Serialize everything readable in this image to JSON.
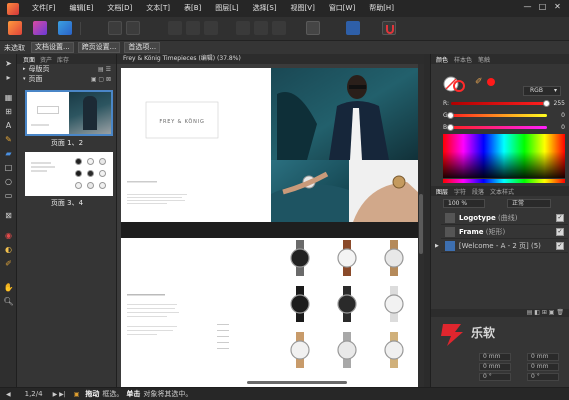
{
  "menu": [
    "文件[F]",
    "编辑[E]",
    "文档[D]",
    "文本[T]",
    "表[B]",
    "图层[L]",
    "选择[S]",
    "视图[V]",
    "窗口[W]",
    "帮助[H]"
  ],
  "window_controls": [
    "—",
    "□",
    "✕"
  ],
  "context": {
    "status": "未选取",
    "buttons": [
      "文档设置...",
      "跨页设置...",
      "首选项..."
    ]
  },
  "pages_panel": {
    "tabs": [
      "页面",
      "资产",
      "库存"
    ],
    "master_label": "母版页",
    "pages_label": "页面",
    "thumbs": [
      {
        "caption": "页面 1、2"
      },
      {
        "caption": "页面 3、4"
      }
    ]
  },
  "document": {
    "title": "Frey & König Timepieces (编辑) (37.8%)",
    "logo_text": "FREY & KÖNIG"
  },
  "color_panel": {
    "tabs": [
      "颜色",
      "样本色",
      "笔触"
    ],
    "mode": "RGB",
    "sliders": [
      {
        "label": "R:",
        "value": "255",
        "fraction": 1.0,
        "color": "#ff3030"
      },
      {
        "label": "G:",
        "value": "0",
        "fraction": 0.0,
        "color": "#c02020"
      },
      {
        "label": "B:",
        "value": "0",
        "fraction": 0.0,
        "color": "#c02020"
      }
    ]
  },
  "layers_panel": {
    "tabs": [
      "图层",
      "字符",
      "段落",
      "文本样式"
    ],
    "opacity": "100 %",
    "blend": "正常",
    "layers": [
      {
        "name": "Logotype",
        "suffix": " (曲线)"
      },
      {
        "name": "Frame",
        "suffix": " (矩形)"
      },
      {
        "name": "",
        "suffix": "[Welcome - A - 2 页] (5)"
      }
    ]
  },
  "transform_panel": {
    "fields": [
      "0 mm",
      "0 mm",
      "0 mm",
      "0 mm",
      "0 °",
      "0 °"
    ]
  },
  "statusbar": {
    "page": "1,2/4",
    "hint_drag": "拖动",
    "hint_drag_text": "框选。",
    "hint_click": "单击",
    "hint_click_text": "对象将其选中。"
  },
  "watermark": "乐软"
}
